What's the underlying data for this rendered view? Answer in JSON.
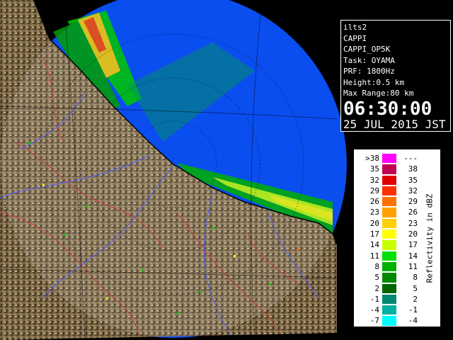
{
  "info": {
    "station": "ilts2",
    "product": "CAPPI",
    "product_id": "CAPPI_OP5K",
    "task": "Task: OYAMA",
    "prf": "PRF: 1800Hz",
    "height": "Height:0.5 km",
    "max_range": "Max Range:80 km",
    "time": "06:30:00",
    "date": "25 JUL 2015 JST"
  },
  "legend": {
    "unit_label": "Reflectivity in dBZ",
    "rows": [
      {
        "lo": ">38",
        "hi": "---",
        "color": "#ff00ff"
      },
      {
        "lo": "35",
        "hi": "38",
        "color": "#c00050"
      },
      {
        "lo": "32",
        "hi": "35",
        "color": "#e00000"
      },
      {
        "lo": "29",
        "hi": "32",
        "color": "#ff3000"
      },
      {
        "lo": "26",
        "hi": "29",
        "color": "#ff7000"
      },
      {
        "lo": "23",
        "hi": "26",
        "color": "#ffa000"
      },
      {
        "lo": "20",
        "hi": "23",
        "color": "#ffd000"
      },
      {
        "lo": "17",
        "hi": "20",
        "color": "#ffff00"
      },
      {
        "lo": "14",
        "hi": "17",
        "color": "#c8ff00"
      },
      {
        "lo": "11",
        "hi": "14",
        "color": "#00e000"
      },
      {
        "lo": "8",
        "hi": "11",
        "color": "#00b000"
      },
      {
        "lo": "5",
        "hi": "8",
        "color": "#008800"
      },
      {
        "lo": "2",
        "hi": "5",
        "color": "#006600"
      },
      {
        "lo": "-1",
        "hi": "2",
        "color": "#008870"
      },
      {
        "lo": "-4",
        "hi": "-1",
        "color": "#00b0a0"
      },
      {
        "lo": "-7",
        "hi": "-4",
        "color": "#00ffff"
      }
    ]
  },
  "map_colors": {
    "sea": "#0a4ef0",
    "land": "#7a6848",
    "river": "#5060ff",
    "boundary": "#d04040",
    "coast": "#000000",
    "range_ring": "#000000"
  }
}
